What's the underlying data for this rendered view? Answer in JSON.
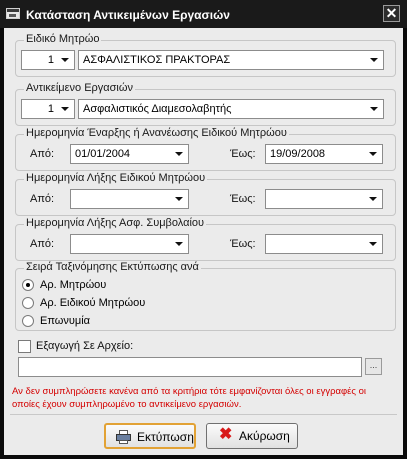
{
  "window": {
    "title": "Κατάσταση Αντικειμένων Εργασιών",
    "close_glyph": "✕"
  },
  "registry": {
    "legend": "Ειδικό Μητρώο",
    "number": "1",
    "value": "ΑΣΦΑΛΙΣΤΙΚΟΣ ΠΡΑΚΤΟΡΑΣ"
  },
  "work_object": {
    "legend": "Αντικείμενο Εργασιών",
    "number": "1",
    "value": "Ασφαλιστικός Διαμεσολαβητής"
  },
  "start_date": {
    "legend": "Ημερομηνία Έναρξης ή Ανανέωσης Ειδικού Μητρώου",
    "from_label": "Από:",
    "from_value": "01/01/2004",
    "to_label": "Έως:",
    "to_value": "19/09/2008"
  },
  "end_date": {
    "legend": "Ημερομηνία Λήξης Ειδικού Μητρώου",
    "from_label": "Από:",
    "from_value": "",
    "to_label": "Έως:",
    "to_value": ""
  },
  "contract_end": {
    "legend": "Ημερομηνία Λήξης Ασφ. Συμβολαίου",
    "from_label": "Από:",
    "from_value": "",
    "to_label": "Έως:",
    "to_value": ""
  },
  "sort": {
    "legend": "Σειρά Ταξινόμησης Εκτύπωσης ανά",
    "options": [
      "Αρ. Μητρώου",
      "Αρ. Ειδικού Μητρώου",
      "Επωνυμία"
    ],
    "selected": "Αρ. Μητρώου"
  },
  "export": {
    "label": "Εξαγωγή Σε Αρχείο:",
    "checked": false,
    "path": "",
    "browse_label": "..."
  },
  "notice": "Αν δεν συμπληρώσετε κανένα από τα κριτήρια τότε εμφανίζονται όλες οι εγγραφές οι οποίες έχουν συμπληρωμένο το αντικείμενο εργασιών.",
  "buttons": {
    "print": "Εκτύπωση",
    "cancel": "Ακύρωση"
  },
  "icons": {
    "window": "window-icon",
    "print": "printer-icon",
    "cancel": "red-x-icon"
  },
  "colors": {
    "titlebar": "#1a1a1a",
    "dialog_bg": "#ebebeb",
    "notice": "#d40000",
    "default_button_border": "#e2a235"
  }
}
